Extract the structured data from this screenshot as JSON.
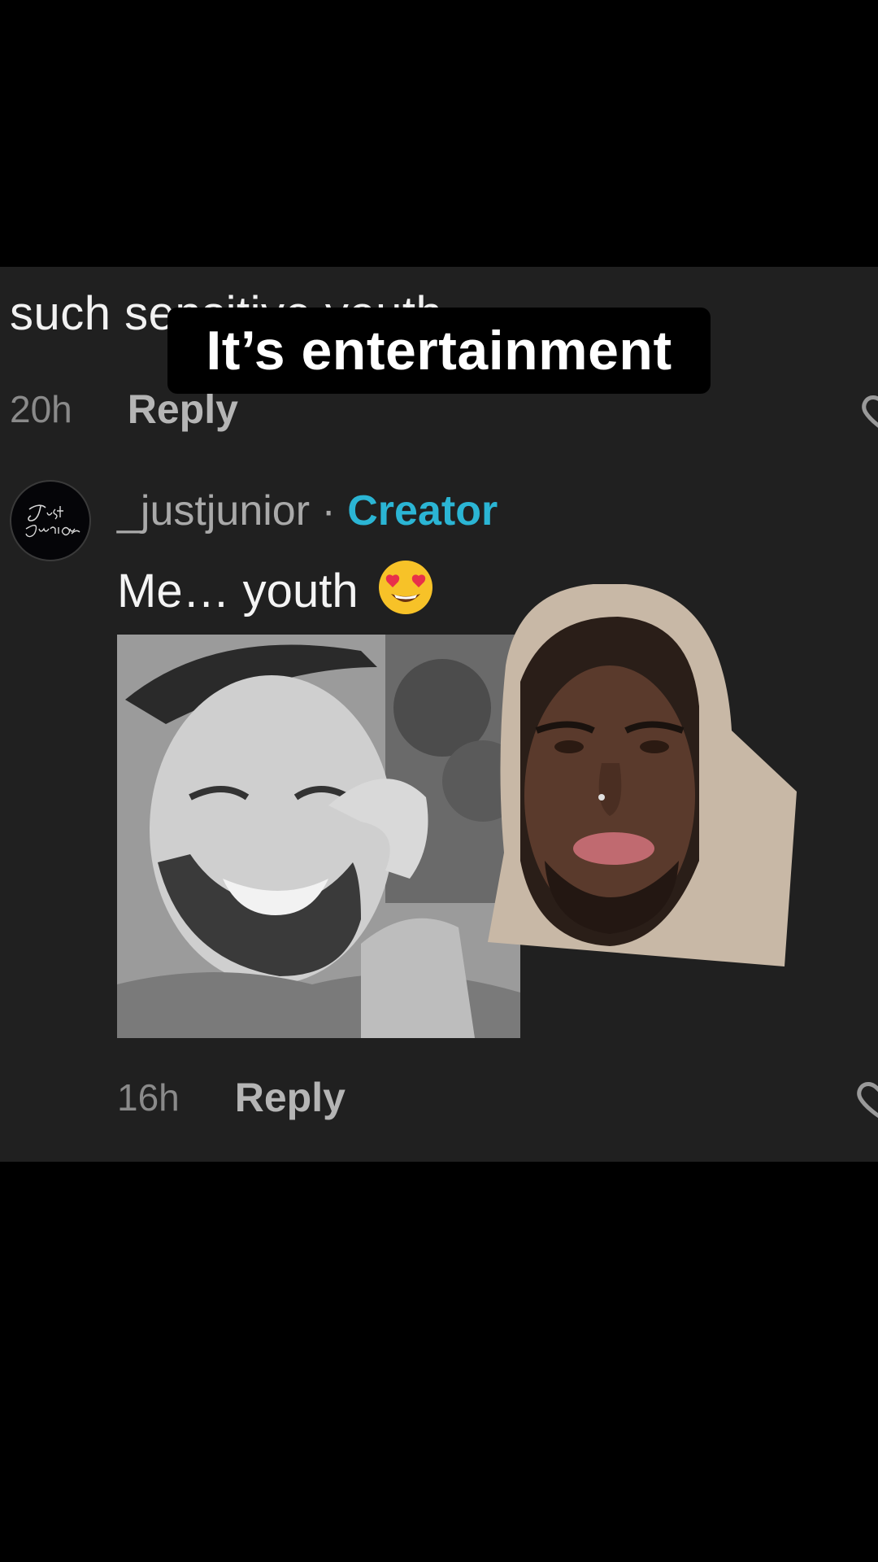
{
  "previous_comment": {
    "text": "such sensitive youth",
    "time": "20h",
    "reply_label": "Reply"
  },
  "overlay": {
    "caption": "It’s entertainment"
  },
  "comment": {
    "author": "_justjunior",
    "separator": " · ",
    "badge": "Creator",
    "text": "Me… youth",
    "emoji_icon": "heart-eyes-emoji",
    "time": "16h",
    "reply_label": "Reply",
    "avatar_text": "Just Junior",
    "image_description_icon": "photo-attachment"
  },
  "colors": {
    "background": "#000000",
    "panel": "#202020",
    "creator_badge": "#2bb5d4",
    "text": "#f4f4f4",
    "muted": "#8a8a8a"
  }
}
